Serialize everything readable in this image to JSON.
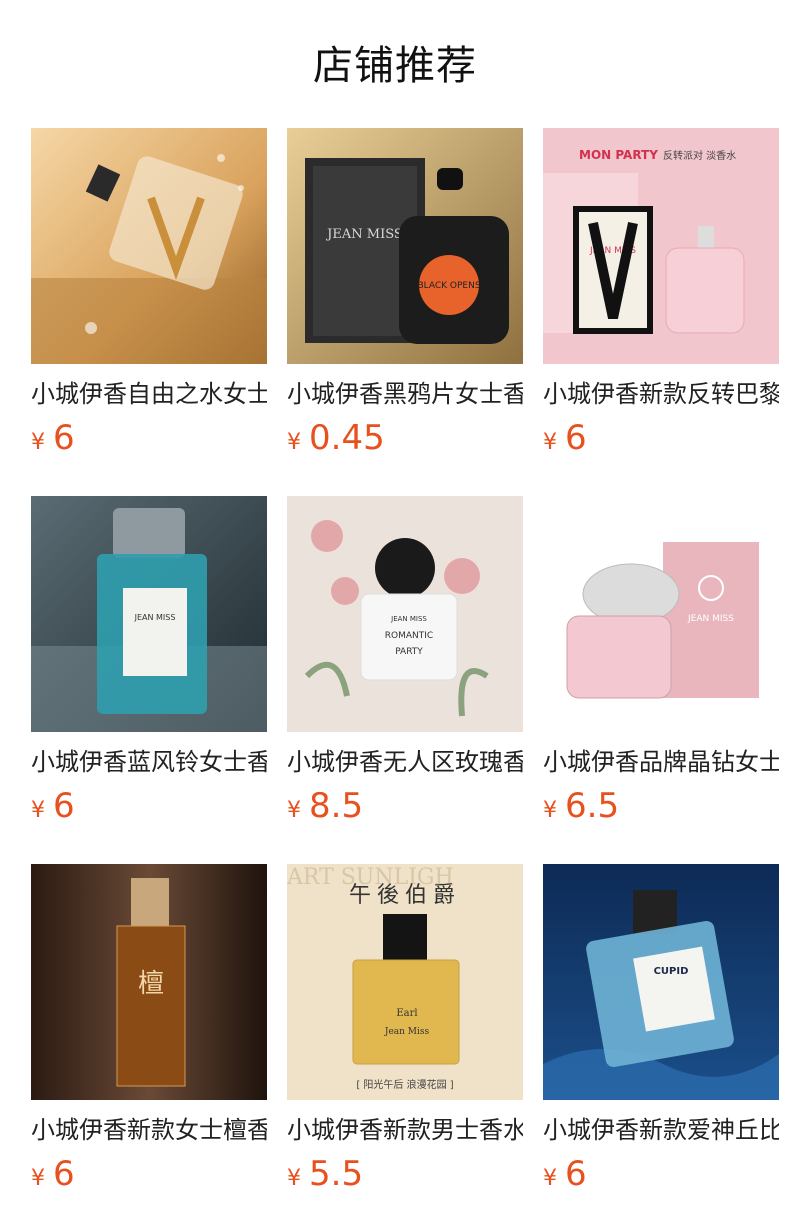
{
  "page": {
    "title": "店铺推荐"
  },
  "currency_symbol": "¥",
  "products": [
    {
      "name": "小城伊香自由之水女士香水",
      "price": "6"
    },
    {
      "name": "小城伊香黑鸦片女士香水",
      "price": "0.45"
    },
    {
      "name": "小城伊香新款反转巴黎",
      "price": "6"
    },
    {
      "name": "小城伊香蓝风铃女士香水",
      "price": "6"
    },
    {
      "name": "小城伊香无人区玫瑰香水",
      "price": "8.5"
    },
    {
      "name": "小城伊香品牌晶钻女士",
      "price": "6.5"
    },
    {
      "name": "小城伊香新款女士檀香",
      "price": "6"
    },
    {
      "name": "小城伊香新款男士香水",
      "price": "5.5"
    },
    {
      "name": "小城伊香新款爱神丘比特",
      "price": "6"
    }
  ],
  "images": {
    "p2": {
      "box_brand": "JEAN MISS",
      "label": "BLACK OPENS"
    },
    "p3": {
      "headline": "MON PARTY",
      "subline": "反转派对 淡香水",
      "box_brand": "JEAN MISS"
    },
    "p4": {
      "label": "JEAN MISS"
    },
    "p5": {
      "brand": "JEAN MISS",
      "name1": "ROMANTIC",
      "name2": "PARTY"
    },
    "p6": {
      "brand": "JEAN MISS"
    },
    "p7": {
      "label": "檀"
    },
    "p8": {
      "headline": "午後伯爵",
      "banner": "ART SUNLIGH",
      "label1": "Earl",
      "label2": "Jean Miss",
      "caption": "[ 阳光午后 浪漫花园 ]"
    },
    "p9": {
      "label": "CUPID"
    }
  },
  "colors": {
    "price": "#e8501d",
    "text": "#222222"
  }
}
